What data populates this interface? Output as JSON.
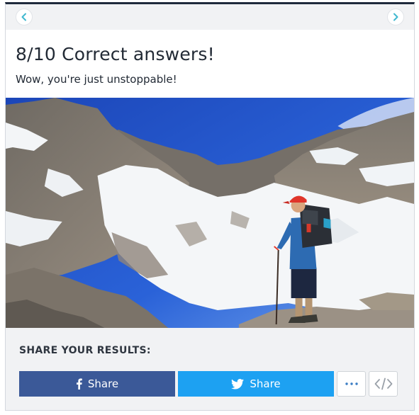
{
  "nav": {
    "prev_icon": "chevron-left-icon",
    "next_icon": "chevron-right-icon",
    "accent_color": "#3fb8cf"
  },
  "result": {
    "title": "8/10 Correct answers!",
    "subtitle": "Wow, you're just unstoppable!"
  },
  "image": {
    "subject": "hiker-in-snowy-mountains-photo"
  },
  "share": {
    "heading": "SHARE YOUR RESULTS:",
    "facebook_label": "Share",
    "facebook_icon": "facebook-icon",
    "facebook_color": "#3b5998",
    "twitter_label": "Share",
    "twitter_icon": "twitter-icon",
    "twitter_color": "#1da1f2",
    "more_icon": "more-dots-icon",
    "embed_icon": "code-embed-icon"
  }
}
